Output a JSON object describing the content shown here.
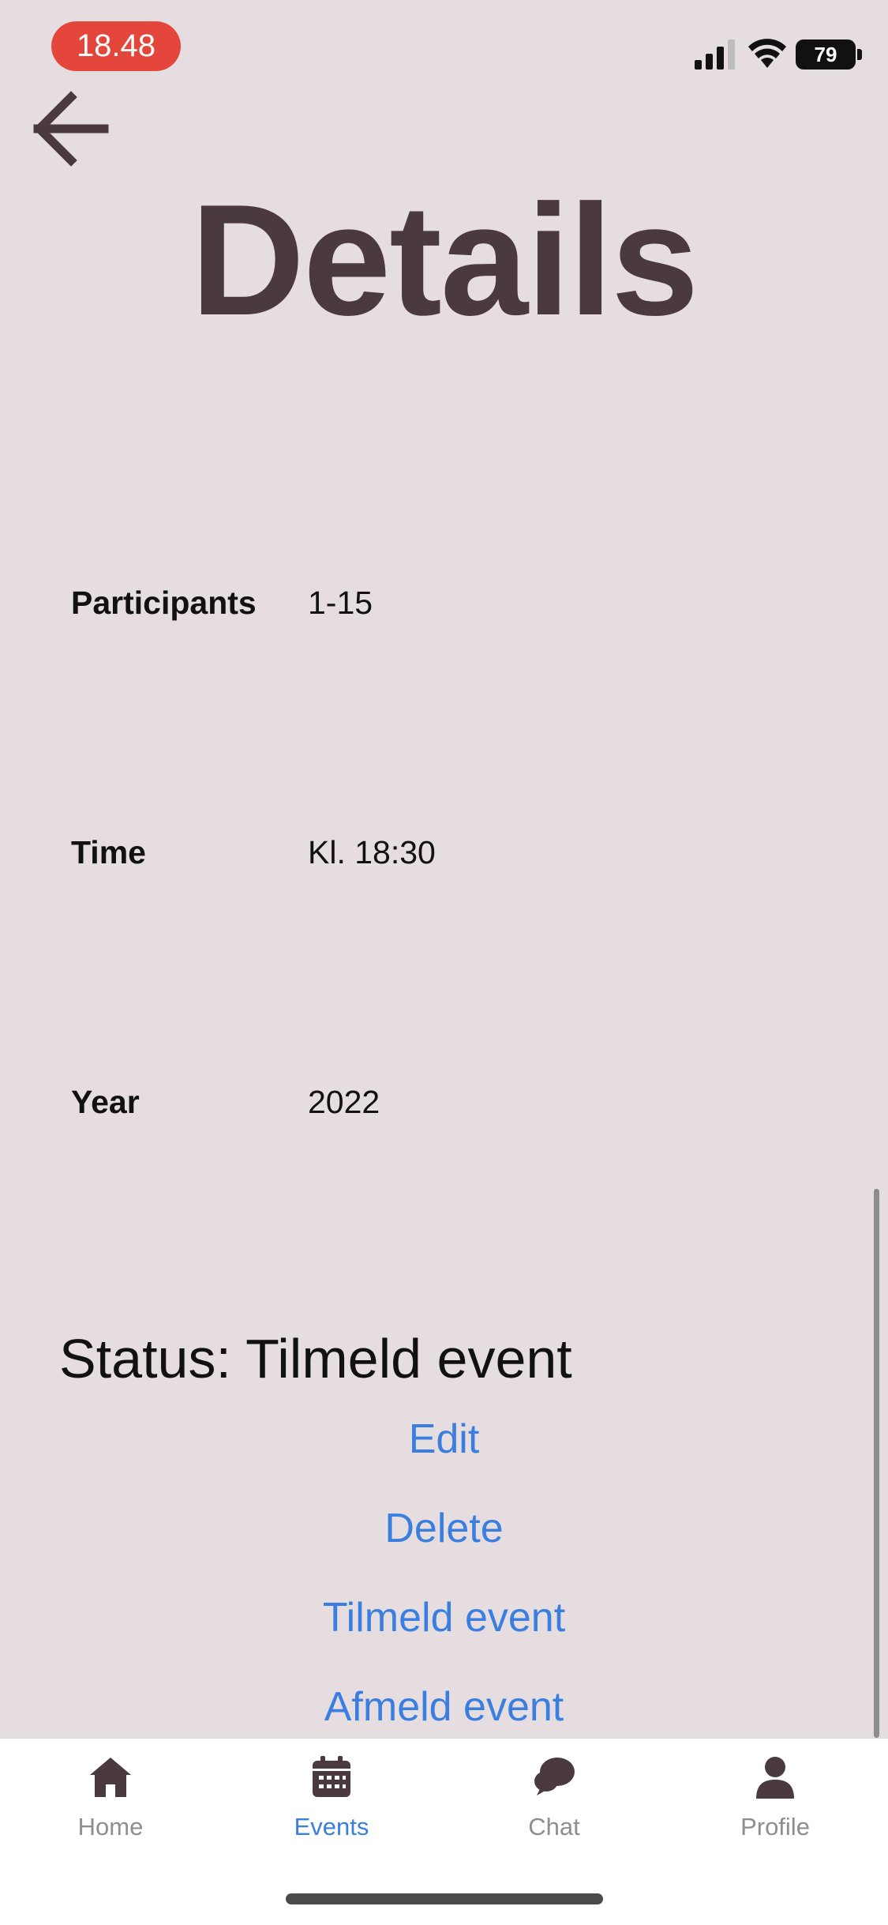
{
  "status_bar": {
    "time": "18.48",
    "battery": "79"
  },
  "header": {
    "title": "Details"
  },
  "details": [
    {
      "label": "Participants",
      "value": "1-15"
    },
    {
      "label": "Time",
      "value": "Kl. 18:30"
    },
    {
      "label": "Year",
      "value": "2022"
    }
  ],
  "status": {
    "text": "Status: Tilmeld event"
  },
  "actions": {
    "edit": "Edit",
    "delete": "Delete",
    "join": "Tilmeld event",
    "leave": "Afmeld event"
  },
  "tabs": [
    {
      "label": "Home",
      "icon": "home-icon"
    },
    {
      "label": "Events",
      "icon": "calendar-icon",
      "active": true
    },
    {
      "label": "Chat",
      "icon": "chat-icon"
    },
    {
      "label": "Profile",
      "icon": "person-icon"
    }
  ],
  "colors": {
    "accent": "#3a7fe0",
    "title": "#4a393f",
    "background": "#e6dde0",
    "time_pill": "#e5463c"
  }
}
